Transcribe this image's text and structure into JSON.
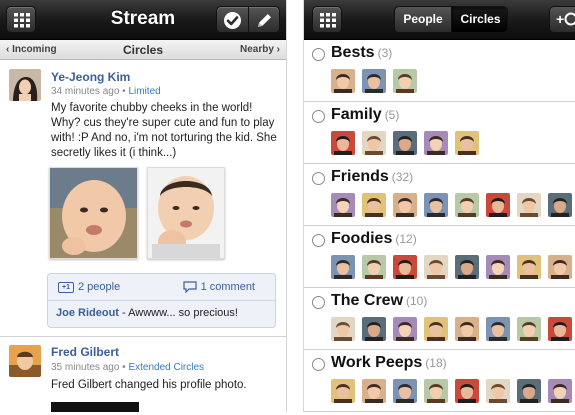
{
  "stream": {
    "title": "Stream",
    "subnav": {
      "left": "‹ Incoming",
      "center": "Circles",
      "right": "Nearby ›"
    },
    "posts": [
      {
        "author": "Ye-Jeong Kim",
        "time": "34 minutes ago",
        "visibility": "Limited",
        "text": "My favorite chubby cheeks in the world! Why? cus they're super cute and fun to play with! :P And no, i'm not torturing the kid. She secretly likes it (i think...)",
        "plus_people": "2 people",
        "comments": "1 comment",
        "comment_author": "Joe Rideout",
        "comment_text": "- Awwww... so precious!"
      },
      {
        "author": "Fred Gilbert",
        "time": "35 minutes ago",
        "visibility": "Extended Circles",
        "text": "Fred Gilbert changed his profile photo."
      }
    ]
  },
  "circles": {
    "tabs": [
      "People",
      "Circles"
    ],
    "active_tab": "Circles",
    "add_label": "+",
    "list": [
      {
        "name": "Bests",
        "count": "(3)",
        "faces": 3
      },
      {
        "name": "Family",
        "count": "(5)",
        "faces": 5
      },
      {
        "name": "Friends",
        "count": "(32)",
        "faces": 8
      },
      {
        "name": "Foodies",
        "count": "(12)",
        "faces": 8
      },
      {
        "name": "The Crew",
        "count": "(10)",
        "faces": 8
      },
      {
        "name": "Work Peeps",
        "count": "(18)",
        "faces": 8
      }
    ]
  },
  "colors": {
    "link": "#3b5e9c",
    "bar": "#1a1a1a",
    "accent_blue": "#3b78c4"
  }
}
